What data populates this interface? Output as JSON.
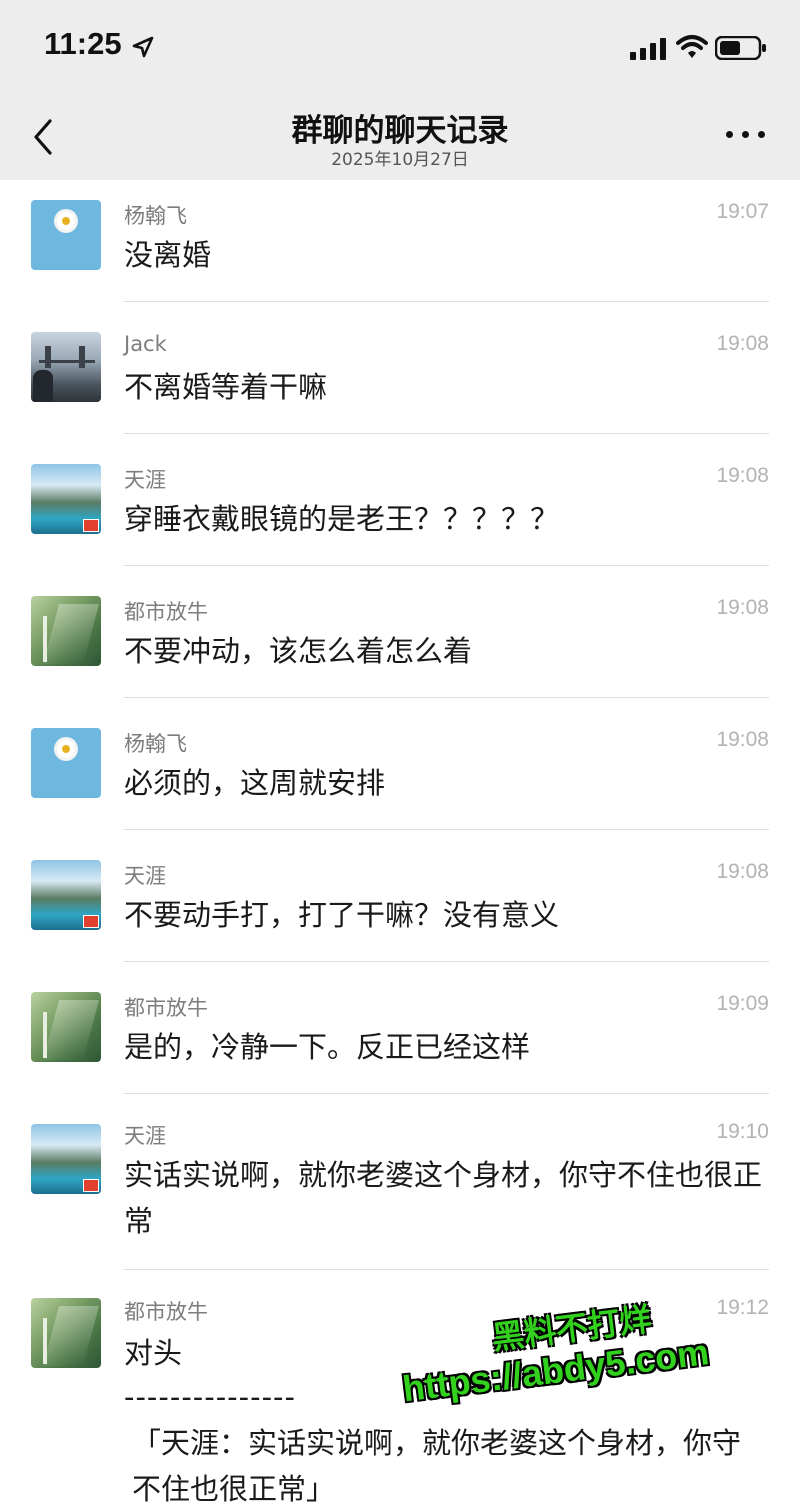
{
  "status_bar": {
    "time": "11:25"
  },
  "nav": {
    "title": "群聊的聊天记录",
    "date": "2025年10月27日"
  },
  "messages": [
    {
      "sender": "杨翰飞",
      "time": "19:07",
      "text": "没离婚"
    },
    {
      "sender": "Jack",
      "time": "19:08",
      "text": "不离婚等着干嘛"
    },
    {
      "sender": "天涯",
      "time": "19:08",
      "text": "穿睡衣戴眼镜的是老王？？？？？"
    },
    {
      "sender": "都市放牛",
      "time": "19:08",
      "text": "不要冲动，该怎么着怎么着"
    },
    {
      "sender": "杨翰飞",
      "time": "19:08",
      "text": "必须的，这周就安排"
    },
    {
      "sender": "天涯",
      "time": "19:08",
      "text": "不要动手打，打了干嘛？没有意义"
    },
    {
      "sender": "都市放牛",
      "time": "19:09",
      "text": "是的，冷静一下。反正已经这样"
    },
    {
      "sender": "天涯",
      "time": "19:10",
      "text": "实话实说啊，就你老婆这个身材，你守不住也很正常"
    },
    {
      "sender": "都市放牛",
      "time": "19:12",
      "text": "对头",
      "separator": "---------------",
      "quote": "「天涯：实话实说啊，就你老婆这个身材，你守不住也很正常」"
    }
  ],
  "watermark": {
    "line1": "黑料不打烊",
    "line2": "https://abdy5.com"
  }
}
